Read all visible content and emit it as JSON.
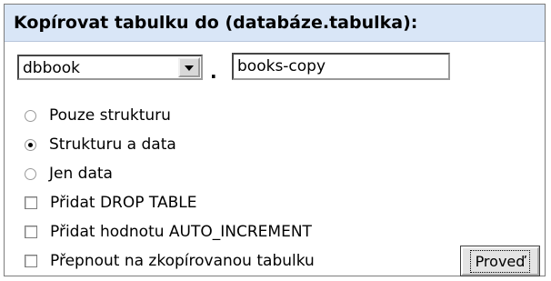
{
  "header": {
    "title": "Kopírovat tabulku do (databáze.tabulka):"
  },
  "database_select": {
    "selected": "dbbook"
  },
  "separator": ".",
  "table_input": {
    "value": "books-copy"
  },
  "copy_options": [
    {
      "label": "Pouze strukturu",
      "checked": false
    },
    {
      "label": "Strukturu a data",
      "checked": true
    },
    {
      "label": "Jen data",
      "checked": false
    }
  ],
  "checkboxes": [
    {
      "label": "Přidat DROP TABLE",
      "checked": false
    },
    {
      "label": "Přidat hodnotu AUTO_INCREMENT",
      "checked": false
    },
    {
      "label": "Přepnout na zkopírovanou tabulku",
      "checked": false
    }
  ],
  "submit_button": {
    "label": "Proveď"
  },
  "colors": {
    "header_bg": "#d9e6f7",
    "panel_border": "#7d7d7d",
    "button_bg": "#e4e4e4"
  }
}
